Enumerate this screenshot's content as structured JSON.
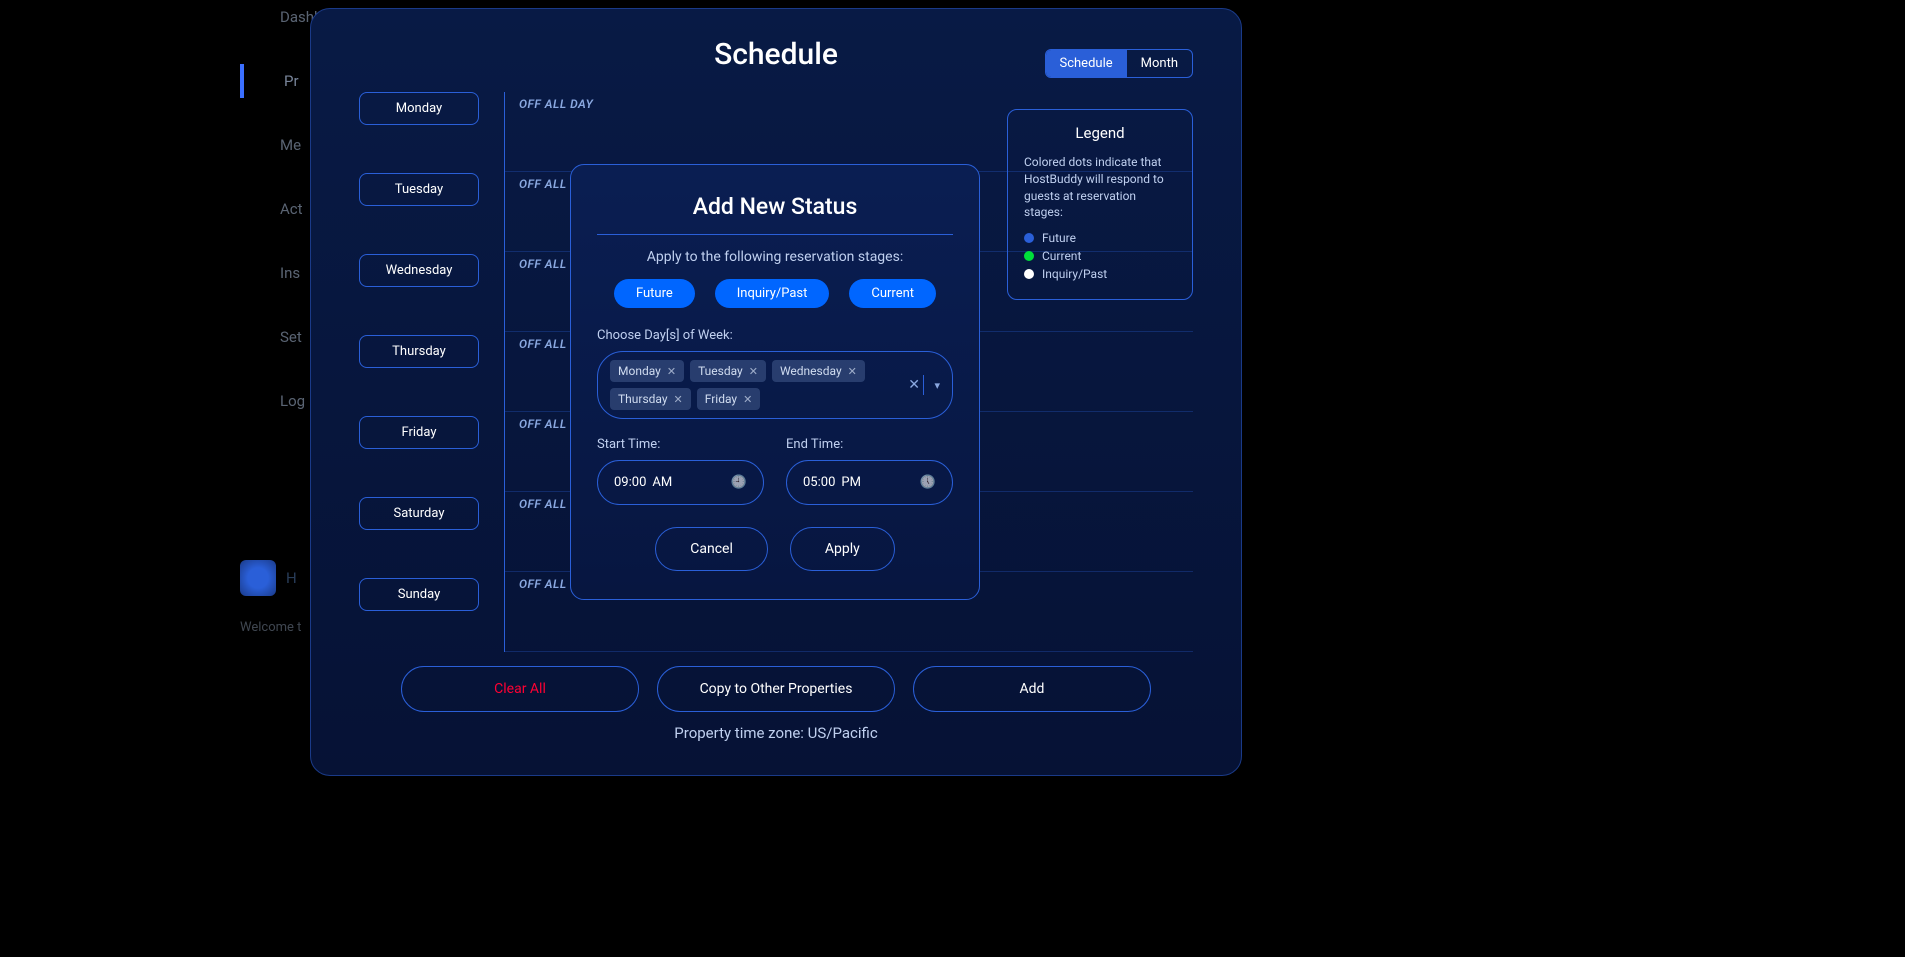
{
  "sidebar": {
    "items": [
      "Dashboard",
      "Pr",
      "Me",
      "Act",
      "Ins",
      "Set",
      "Log"
    ],
    "logo_text": "H",
    "welcome": "Welcome t"
  },
  "modal": {
    "title": "Schedule",
    "toggle": {
      "schedule": "Schedule",
      "month": "Month"
    },
    "days": [
      "Monday",
      "Tuesday",
      "Wednesday",
      "Thursday",
      "Friday",
      "Saturday",
      "Sunday"
    ],
    "off_label": "OFF ALL DAY",
    "legend": {
      "title": "Legend",
      "desc": "Colored dots indicate that HostBuddy will respond to guests at reservation stages:",
      "items": [
        {
          "color": "blue",
          "label": "Future"
        },
        {
          "color": "green",
          "label": "Current"
        },
        {
          "color": "white",
          "label": "Inquiry/Past"
        }
      ]
    },
    "footer": {
      "clear": "Clear All",
      "copy": "Copy to Other Properties",
      "add": "Add"
    },
    "timezone": "Property time zone: US/Pacific"
  },
  "inner": {
    "title": "Add New Status",
    "subtitle": "Apply to the following reservation stages:",
    "stages": [
      "Future",
      "Inquiry/Past",
      "Current"
    ],
    "choose_label": "Choose Day[s] of Week:",
    "chips": [
      "Monday",
      "Tuesday",
      "Wednesday",
      "Thursday",
      "Friday"
    ],
    "start_label": "Start Time:",
    "end_label": "End Time:",
    "start_time": "09:00",
    "start_ampm": "AM",
    "end_time": "05:00",
    "end_ampm": "PM",
    "cancel": "Cancel",
    "apply": "Apply"
  }
}
